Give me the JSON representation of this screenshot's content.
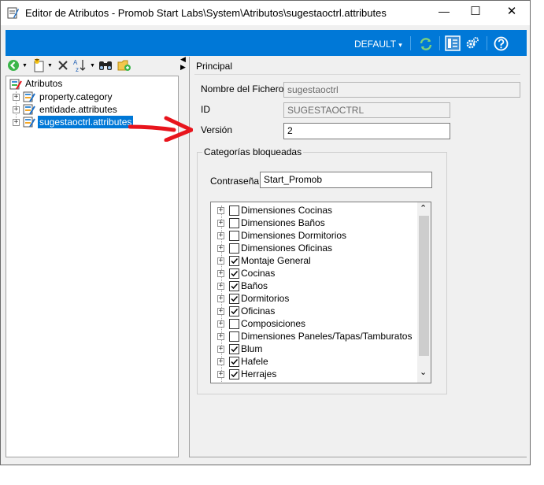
{
  "window": {
    "title": "Editor de Atributos - Promob Start Labs\\System\\Atributos\\sugestaoctrl.attributes",
    "minimize_glyph": "—",
    "maximize_glyph": "☐",
    "close_glyph": "✕"
  },
  "toolbar": {
    "profile_label": "DEFAULT",
    "profile_arrow": "▾"
  },
  "tree": {
    "root_label": "Atributos",
    "items": [
      {
        "label": "property.category"
      },
      {
        "label": "entidade.attributes"
      },
      {
        "label": "sugestaoctrl.attributes"
      }
    ]
  },
  "splitter": {
    "arrows": [
      "◀",
      "▶"
    ]
  },
  "panel": {
    "header": "Principal",
    "fields": {
      "filename_label": "Nombre del Fichero",
      "filename_value": "sugestaoctrl",
      "id_label": "ID",
      "id_value": "SUGESTAOCTRL",
      "version_label": "Versión",
      "version_value": "2"
    },
    "group": {
      "title": "Categorías bloqueadas",
      "password_label": "Contraseña:",
      "password_value": "Start_Promob",
      "categories": [
        {
          "label": "Dimensiones Cocinas",
          "checked": false
        },
        {
          "label": "Dimensiones Baños",
          "checked": false
        },
        {
          "label": "Dimensiones Dormitorios",
          "checked": false
        },
        {
          "label": "Dimensiones Oficinas",
          "checked": false
        },
        {
          "label": "Montaje General",
          "checked": true
        },
        {
          "label": "Cocinas",
          "checked": true
        },
        {
          "label": "Baños",
          "checked": true
        },
        {
          "label": "Dormitorios",
          "checked": true
        },
        {
          "label": "Oficinas",
          "checked": true
        },
        {
          "label": "Composiciones",
          "checked": false
        },
        {
          "label": "Dimensiones Paneles/Tapas/Tamburatos",
          "checked": false
        },
        {
          "label": "Blum",
          "checked": true
        },
        {
          "label": "Hafele",
          "checked": true
        },
        {
          "label": "Herrajes",
          "checked": true
        }
      ],
      "expand_glyph": "+",
      "scroll_up_glyph": "⌃",
      "scroll_down_glyph": "⌄"
    }
  },
  "colors": {
    "accent": "#0078d7",
    "selection": "#0078d7",
    "arrow": "#e8141c",
    "toolbar_green": "#3bb54a"
  }
}
